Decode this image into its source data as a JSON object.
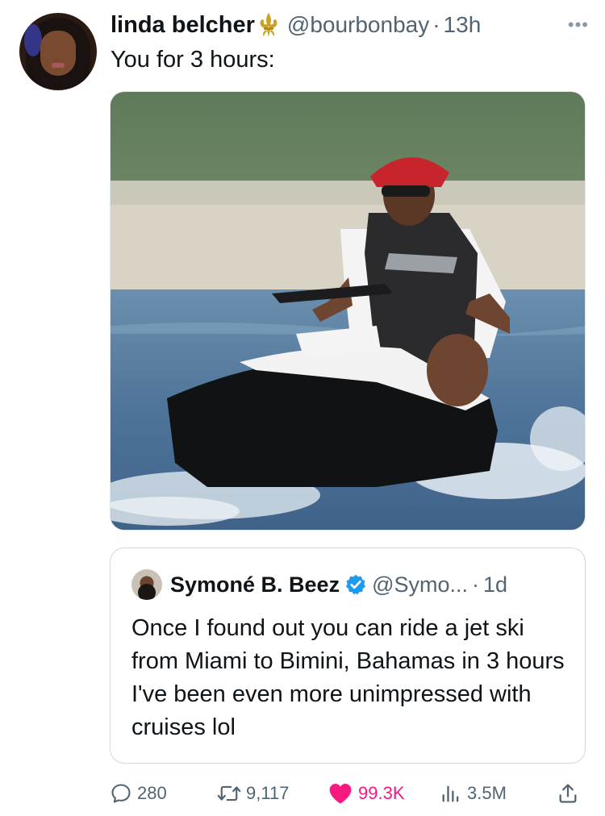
{
  "tweet": {
    "author_name": "linda belcher",
    "author_emoji": "fleur-de-lis",
    "handle": "@bourbonbay",
    "separator": "·",
    "time": "13h",
    "more_icon": "more-horizontal-icon",
    "text": "You for 3 hours:",
    "media_alt": "photo"
  },
  "quote": {
    "author_name": "Symoné B. Beez",
    "verified": true,
    "handle": "@Symo...",
    "separator": "·",
    "time": "1d",
    "text": "Once I found out you can ride a jet ski from Miami to Bimini, Bahamas in 3 hours I've been even more unimpressed with cruises lol"
  },
  "actions": {
    "replies": "280",
    "retweets": "9,117",
    "likes": "99.3K",
    "views": "3.5M"
  },
  "colors": {
    "like": "#f91880",
    "muted": "#536471",
    "verified": "#1d9bf0",
    "fleur": "#c9a227"
  }
}
